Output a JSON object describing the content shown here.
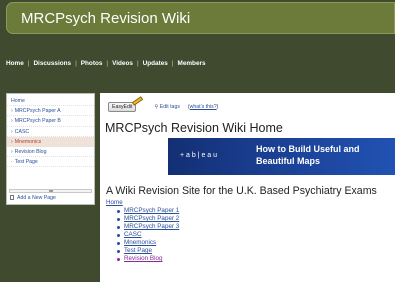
{
  "site": {
    "title": "MRCPsych Revision Wiki"
  },
  "nav": {
    "items": [
      "Home",
      "Discussions",
      "Photos",
      "Videos",
      "Updates",
      "Members"
    ]
  },
  "sidebar": {
    "items": [
      {
        "label": "Home",
        "caret": false,
        "active": false
      },
      {
        "label": "MRCPsych Paper A",
        "caret": true,
        "active": false
      },
      {
        "label": "MRCPsych Paper B",
        "caret": true,
        "active": false
      },
      {
        "label": "CASC",
        "caret": true,
        "active": false
      },
      {
        "label": "Mnemonics",
        "caret": true,
        "active": true
      },
      {
        "label": "Revision Blog",
        "caret": true,
        "active": false
      },
      {
        "label": "Test Page",
        "caret": false,
        "active": false
      }
    ],
    "add_page": "Add a New Page"
  },
  "toolbar": {
    "easyedit": "EasyEdit",
    "edit_tags": "Edit tags",
    "whats_this": "what's this?"
  },
  "page": {
    "title": "MRCPsych Revision Wiki Home",
    "subtitle": "A Wiki Revision Site for the U.K. Based Psychiatry Exams",
    "home_link": "Home",
    "links": [
      "MRCPsych Paper 1",
      "MRCPsych Paper 2",
      "MRCPsych Paper 3",
      "CASC",
      "Mnemonics",
      "Test Page",
      "Revision Blog"
    ]
  },
  "ad": {
    "logo": "+ a b | e a u",
    "line1": "How to Build Useful and",
    "line2": "Beautiful Maps"
  }
}
